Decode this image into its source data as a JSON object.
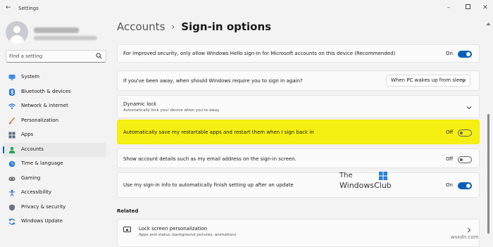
{
  "app": {
    "title": "Settings"
  },
  "window_controls": [
    "minimize-icon",
    "maximize-icon",
    "close-icon"
  ],
  "search": {
    "placeholder": "Find a setting",
    "value": ""
  },
  "nav": [
    {
      "label": "System",
      "icon": "monitor-icon",
      "active": false
    },
    {
      "label": "Bluetooth & devices",
      "icon": "bluetooth-icon",
      "active": false
    },
    {
      "label": "Network & internet",
      "icon": "wifi-icon",
      "active": false
    },
    {
      "label": "Personalization",
      "icon": "brush-icon",
      "active": false
    },
    {
      "label": "Apps",
      "icon": "apps-grid-icon",
      "active": false
    },
    {
      "label": "Accounts",
      "icon": "person-icon",
      "active": true
    },
    {
      "label": "Time & language",
      "icon": "globe-clock-icon",
      "active": false
    },
    {
      "label": "Gaming",
      "icon": "gamepad-icon",
      "active": false
    },
    {
      "label": "Accessibility",
      "icon": "accessibility-icon",
      "active": false
    },
    {
      "label": "Privacy & security",
      "icon": "shield-icon",
      "active": false
    },
    {
      "label": "Windows Update",
      "icon": "sync-icon",
      "active": false
    }
  ],
  "breadcrumb": {
    "parent": "Accounts",
    "separator": "›",
    "current": "Sign-in options"
  },
  "settings": {
    "hello_only": {
      "text": "For improved security, only allow Windows Hello sign-in for Microsoft accounts on this device (Recommended)",
      "state": "On"
    },
    "require_signin": {
      "text": "If you've been away, when should Windows require you to sign in again?",
      "selected": "When PC wakes up from sleep"
    },
    "dynamic_lock": {
      "title": "Dynamic lock",
      "subtitle": "Automatically lock your device when you're away"
    },
    "restart_apps": {
      "text": "Automatically save my restartable apps and restart them when I sign back in",
      "state": "Off"
    },
    "account_details": {
      "text": "Show account details such as my email address on the sign-in screen.",
      "state": "Off"
    },
    "signin_info": {
      "text": "Use my sign-in info to automatically finish setting up after an update",
      "state": "On"
    }
  },
  "related": {
    "heading": "Related",
    "lock_screen": {
      "title": "Lock screen personalization",
      "subtitle": "Apps and status, background pictures, animations"
    }
  },
  "watermark": {
    "line1": "The",
    "line2": "WindowsClub"
  },
  "footer": "wsxdn.com",
  "colors": {
    "accent": "#005fb8",
    "highlight": "#f5f011",
    "background": "#f3f3f3"
  }
}
